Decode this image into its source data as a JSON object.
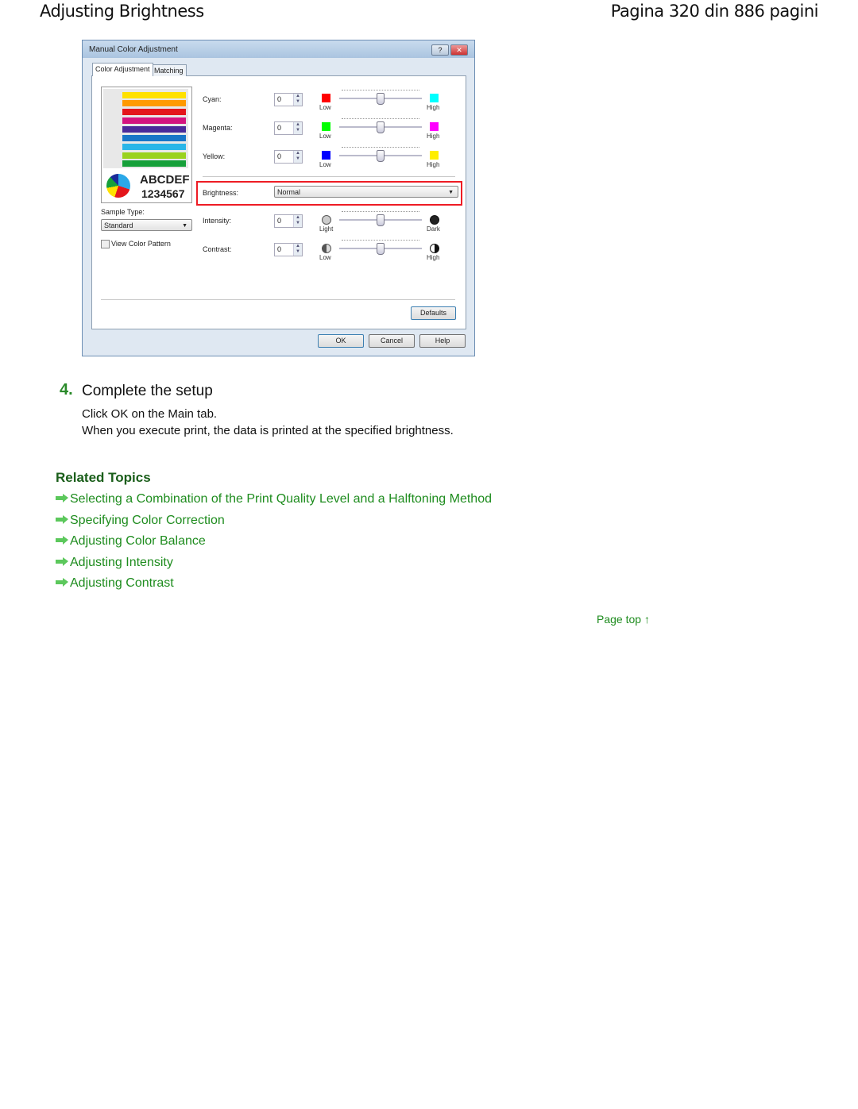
{
  "header": {
    "title": "Adjusting Brightness",
    "page_info": "Pagina 320 din 886 pagini"
  },
  "dialog": {
    "title": "Manual Color Adjustment",
    "help_btn": "?",
    "close_btn": "✕",
    "tabs": [
      {
        "label": "Color Adjustment",
        "active": true
      },
      {
        "label": "Matching",
        "active": false
      }
    ],
    "preview": {
      "text1": "ABCDEF",
      "text2": "1234567"
    },
    "sample_type": {
      "label": "Sample Type:",
      "value": "Standard"
    },
    "view_pattern": {
      "label": "View Color Pattern",
      "checked": false
    },
    "sliders": [
      {
        "label": "Cyan:",
        "value": "0",
        "low": "Low",
        "high": "High",
        "low_color": "#ff0000",
        "high_color": "#00ffff",
        "level": 0
      },
      {
        "label": "Magenta:",
        "value": "0",
        "low": "Low",
        "high": "High",
        "low_color": "#00ff00",
        "high_color": "#ff00ff",
        "level": 0
      },
      {
        "label": "Yellow:",
        "value": "0",
        "low": "Low",
        "high": "High",
        "low_color": "#0000ff",
        "high_color": "#ffee00",
        "level": 0
      }
    ],
    "brightness": {
      "label": "Brightness:",
      "value": "Normal",
      "highlight_color": "#ee1c24"
    },
    "sliders2": [
      {
        "label": "Intensity:",
        "value": "0",
        "low": "Light",
        "high": "Dark",
        "level": 0
      },
      {
        "label": "Contrast:",
        "value": "0",
        "low": "Low",
        "high": "High",
        "level": 0
      }
    ],
    "defaults": "Defaults",
    "ok": "OK",
    "cancel": "Cancel",
    "help": "Help"
  },
  "step": {
    "number": "4.",
    "title": "Complete the setup",
    "lines": [
      "Click OK on the Main tab.",
      "When you execute print, the data is printed at the specified brightness."
    ]
  },
  "related": {
    "title": "Related Topics",
    "links": [
      "Selecting a Combination of the Print Quality Level and a Halftoning Method",
      "Specifying Color Correction",
      "Adjusting Color Balance",
      "Adjusting Intensity",
      "Adjusting Contrast"
    ]
  },
  "page_top": "Page top ↑",
  "colors": {
    "link": "#1e8c1e",
    "heading": "#1a5e1a",
    "step_number": "#2a8a2a"
  }
}
